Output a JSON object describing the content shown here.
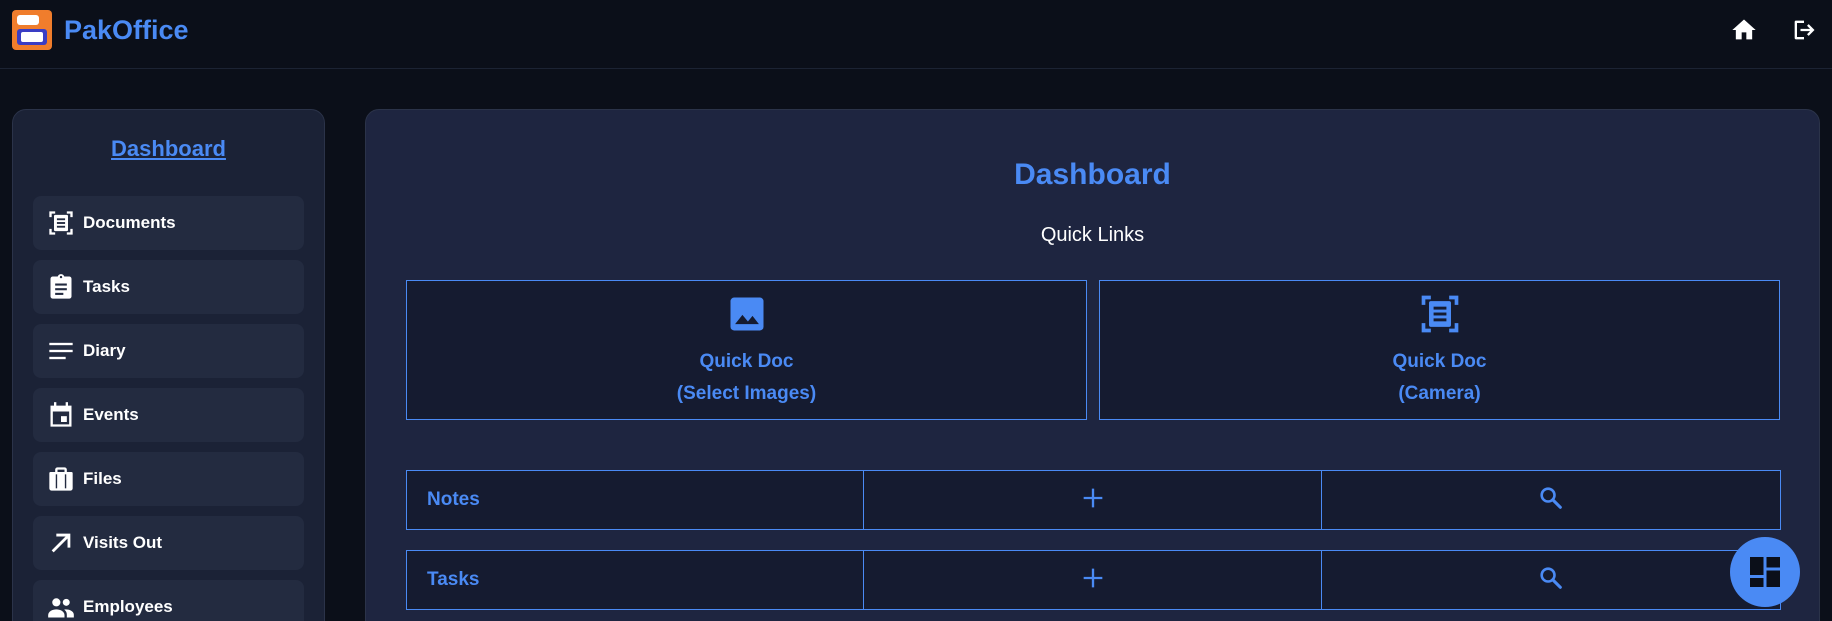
{
  "header": {
    "brand": "PakOffice",
    "icons": {
      "home": "home-icon",
      "logout": "logout-icon",
      "logo": "pakoffice-logo"
    },
    "colors": {
      "accent": "#4a8af4",
      "background": "#0b0f19"
    }
  },
  "sidebar": {
    "title": "Dashboard",
    "items": [
      {
        "label": "Documents",
        "icon": "document-scan-icon"
      },
      {
        "label": "Tasks",
        "icon": "clipboard-icon"
      },
      {
        "label": "Diary",
        "icon": "lines-icon"
      },
      {
        "label": "Events",
        "icon": "calendar-icon"
      },
      {
        "label": "Files",
        "icon": "briefcase-icon"
      },
      {
        "label": "Visits Out",
        "icon": "arrow-up-right-icon"
      },
      {
        "label": "Employees",
        "icon": "people-icon"
      }
    ]
  },
  "main": {
    "title": "Dashboard",
    "subtitle": "Quick Links",
    "quick_links": [
      {
        "line1": "Quick Doc",
        "line2": "(Select Images)",
        "icon": "image-icon"
      },
      {
        "line1": "Quick Doc",
        "line2": "(Camera)",
        "icon": "document-scan-icon"
      }
    ],
    "rows": [
      {
        "label": "Notes",
        "add_icon": "plus-icon",
        "search_icon": "search-icon"
      },
      {
        "label": "Tasks",
        "add_icon": "plus-icon",
        "search_icon": "search-icon"
      }
    ]
  },
  "fab": {
    "icon": "dashboard-grid-icon"
  }
}
